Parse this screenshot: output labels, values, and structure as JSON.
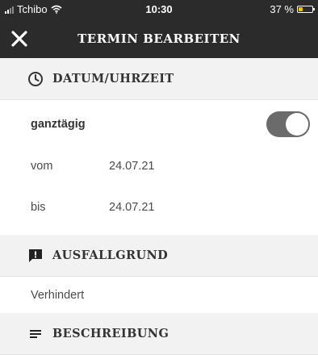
{
  "status_bar": {
    "carrier": "Tchibo",
    "time": "10:30",
    "battery": "37 %",
    "icons": [
      "signal-icon",
      "wifi-icon",
      "battery-icon"
    ]
  },
  "header": {
    "title": "TERMIN BEARBEITEN",
    "close_icon": "close-icon"
  },
  "sections": {
    "datetime": {
      "title": "DATUM/UHRZEIT",
      "icon": "clock-icon",
      "all_day_label": "ganztägig",
      "all_day_on": true,
      "from_label": "vom",
      "from_value": "24.07.21",
      "to_label": "bis",
      "to_value": "24.07.21"
    },
    "reason": {
      "title": "AUSFALLGRUND",
      "icon": "alert-message-icon",
      "value": "Verhindert"
    },
    "description": {
      "title": "BESCHREIBUNG",
      "icon": "notes-icon"
    }
  },
  "colors": {
    "header_bg": "#2b2b2b",
    "section_bg": "#f2f2f2",
    "toggle_on": "#6b6b6b",
    "battery_low": "#f5c400"
  }
}
